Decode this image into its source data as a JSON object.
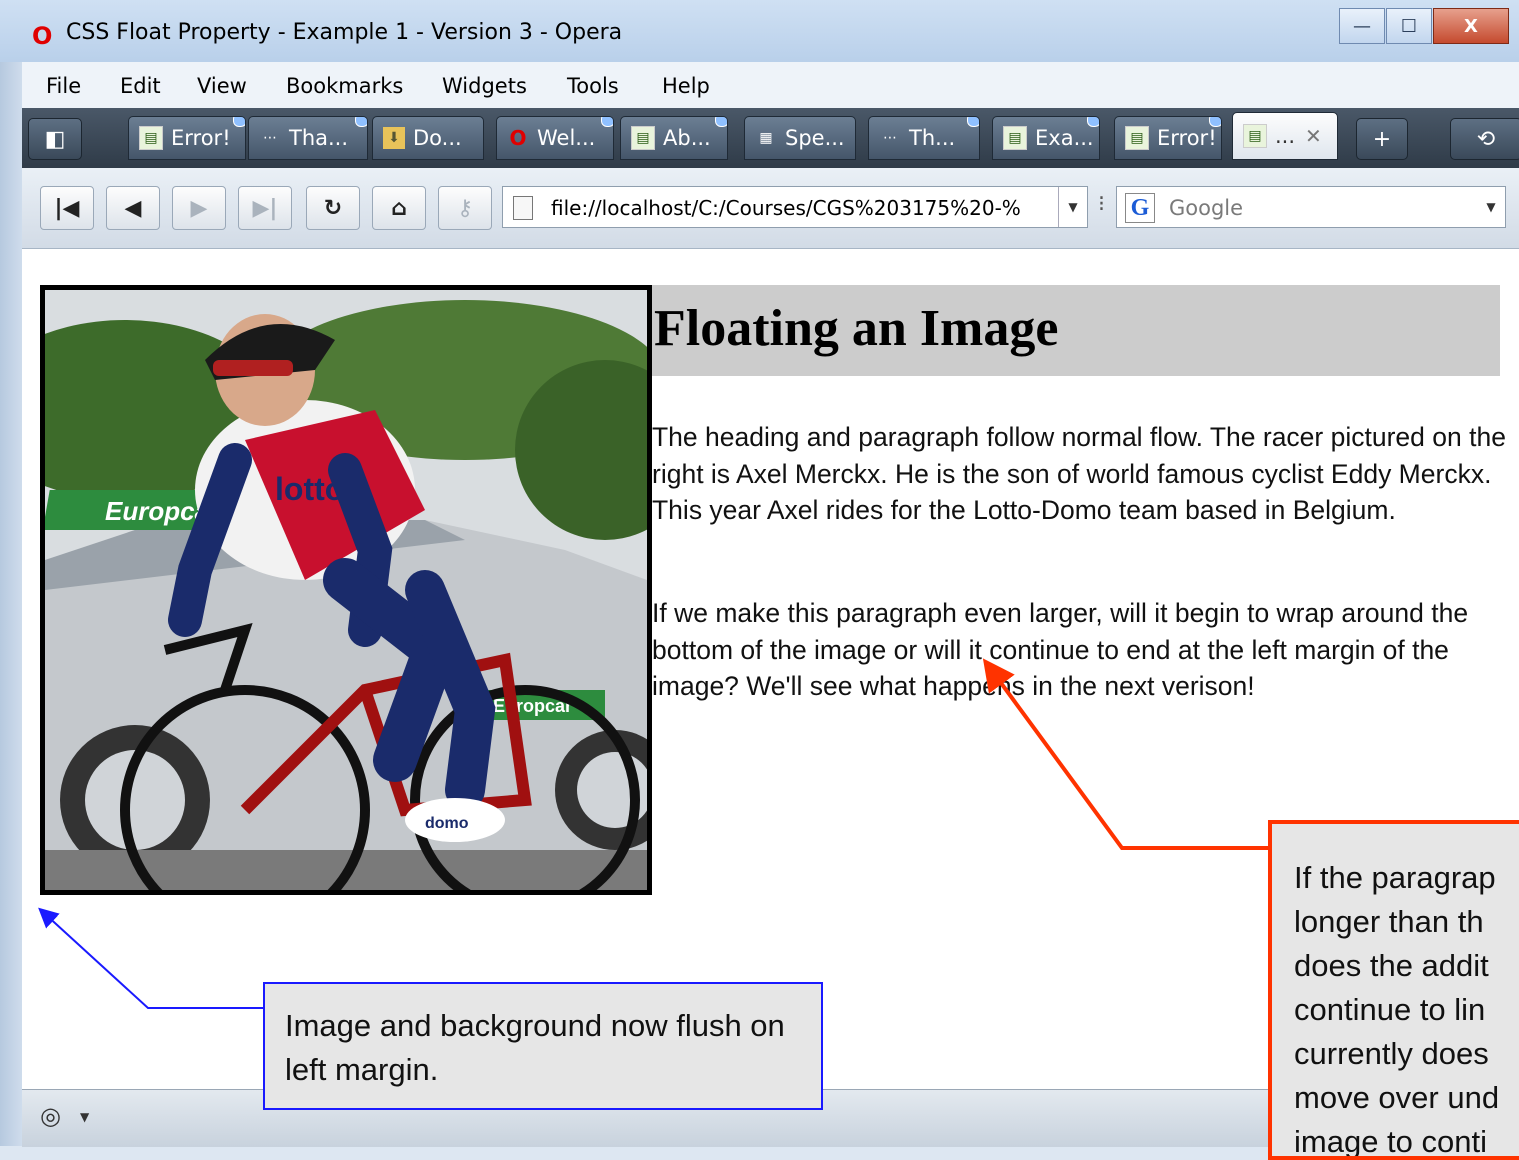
{
  "window": {
    "title": "CSS Float Property - Example 1 - Version 3 - Opera",
    "controls": {
      "minimize": "—",
      "maximize": "☐",
      "close": "X"
    }
  },
  "menu": [
    "File",
    "Edit",
    "View",
    "Bookmarks",
    "Widgets",
    "Tools",
    "Help"
  ],
  "tabs": [
    {
      "label": "Error!",
      "icon": "page-icon"
    },
    {
      "label": "Tha...",
      "icon": "speech-icon"
    },
    {
      "label": "Do...",
      "icon": "download-icon"
    },
    {
      "label": "Wel...",
      "icon": "opera-icon"
    },
    {
      "label": "Ab...",
      "icon": "page-icon"
    },
    {
      "label": "Spe...",
      "icon": "grid-icon"
    },
    {
      "label": "Th...",
      "icon": "speech-icon"
    },
    {
      "label": "Exa...",
      "icon": "page-icon"
    },
    {
      "label": "Error!",
      "icon": "page-icon"
    },
    {
      "label": "...",
      "icon": "page-icon",
      "active": true
    }
  ],
  "toolbar": {
    "new_tab": "+",
    "address": "file://localhost/C:/Courses/CGS%203175%20-%",
    "search_engine": "G",
    "search_placeholder": "Google"
  },
  "page": {
    "heading": "Floating an Image",
    "para1": "The heading and paragraph follow normal flow. The racer pictured on the right is Axel Merckx. He is the son of world famous cyclist Eddy Merckx. This year Axel rides for the Lotto-Domo team based in Belgium.",
    "para2": "If we make this paragraph even larger, will it begin to wrap around the bottom of the image or will it continue to end at the left margin of the image? We'll see what happens in the next verison!",
    "photo_text": {
      "sign": "Europca",
      "car_sign": "Europcar",
      "jersey": "lotto",
      "shoe": "domo"
    }
  },
  "annotations": {
    "blue": "Image and background now flush on left margin.",
    "red": [
      "If the paragrap",
      "longer than th",
      "does the addit",
      "continue to lin",
      "currently does",
      "move over und",
      "image to conti"
    ]
  },
  "colors": {
    "blue_callout": "#1a1aff",
    "red_callout": "#ff3300",
    "heading_bg": "#cccccc"
  }
}
